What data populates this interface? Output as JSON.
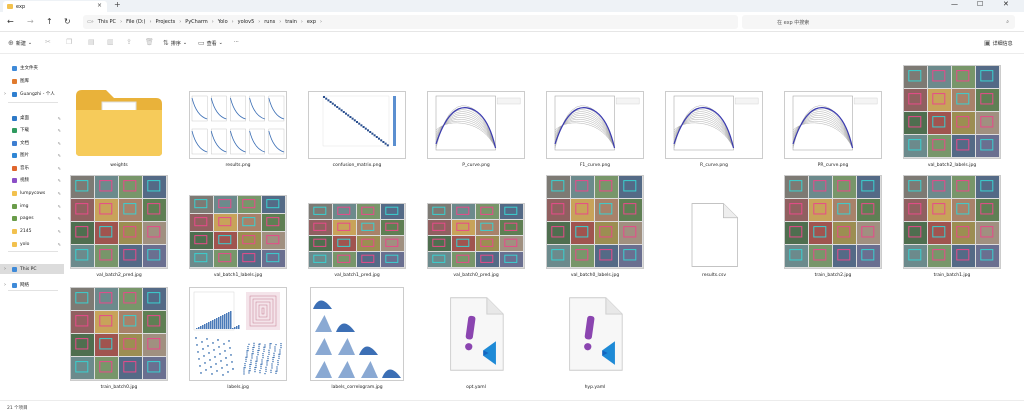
{
  "window": {
    "tab_title": "exp",
    "minimize": "—",
    "maximize": "☐",
    "close": "✕"
  },
  "address": {
    "crumbs": [
      "This PC",
      "File (D:)",
      "Projects",
      "PyCharm",
      "Yolo",
      "yolov5",
      "runs",
      "train",
      "exp"
    ],
    "search_placeholder": "在 exp 中搜索"
  },
  "toolbar": {
    "new_label": "新建",
    "sort_label": "排序",
    "view_label": "查看",
    "more_label": "···",
    "details_label": "详细信息"
  },
  "sidebar": {
    "items": [
      {
        "label": "主文件夹",
        "color": "#3f8ad8"
      },
      {
        "label": "图库",
        "color": "#e07a2e"
      },
      {
        "label": "Guangzhi - 个人",
        "color": "#2f7fd0"
      },
      {
        "label": "桌面",
        "color": "#2d79c7"
      },
      {
        "label": "下载",
        "color": "#2f9a5f"
      },
      {
        "label": "文档",
        "color": "#3d7ed1"
      },
      {
        "label": "图片",
        "color": "#2f86d5"
      },
      {
        "label": "音乐",
        "color": "#e0662e"
      },
      {
        "label": "视频",
        "color": "#8b4fc7"
      },
      {
        "label": "lumpycows",
        "color": "#f2c14e"
      },
      {
        "label": "img",
        "color": "#6a9c4a"
      },
      {
        "label": "pages",
        "color": "#6a9c4a"
      },
      {
        "label": "2145",
        "color": "#f2c14e"
      },
      {
        "label": "yolo",
        "color": "#f2c14e"
      },
      {
        "label": "This PC",
        "color": "#3f8ad8"
      },
      {
        "label": "网络",
        "color": "#3f8ad8"
      }
    ]
  },
  "files": [
    {
      "name": "weights",
      "kind": "folder"
    },
    {
      "name": "results.png",
      "kind": "grid"
    },
    {
      "name": "confusion_matrix.png",
      "kind": "matrix"
    },
    {
      "name": "P_curve.png",
      "kind": "curve"
    },
    {
      "name": "F1_curve.png",
      "kind": "curve"
    },
    {
      "name": "R_curve.png",
      "kind": "curve"
    },
    {
      "name": "PR_curve.png",
      "kind": "curve"
    },
    {
      "name": "val_batch2_labels.jpg",
      "kind": "batch"
    },
    {
      "name": "val_batch2_pred.jpg",
      "kind": "batch"
    },
    {
      "name": "val_batch1_labels.jpg",
      "kind": "batch"
    },
    {
      "name": "val_batch1_pred.jpg",
      "kind": "batch"
    },
    {
      "name": "val_batch0_pred.jpg",
      "kind": "batch"
    },
    {
      "name": "val_batch0_labels.jpg",
      "kind": "batch"
    },
    {
      "name": "results.csv",
      "kind": "blank"
    },
    {
      "name": "train_batch2.jpg",
      "kind": "batch"
    },
    {
      "name": "train_batch1.jpg",
      "kind": "batch"
    },
    {
      "name": "train_batch0.jpg",
      "kind": "batch"
    },
    {
      "name": "labels.jpg",
      "kind": "scatter"
    },
    {
      "name": "labels_correlogram.jpg",
      "kind": "correlogram"
    },
    {
      "name": "opt.yaml",
      "kind": "yaml"
    },
    {
      "name": "hyp.yaml",
      "kind": "yaml"
    }
  ],
  "status": {
    "count_text": "21 个项目"
  }
}
